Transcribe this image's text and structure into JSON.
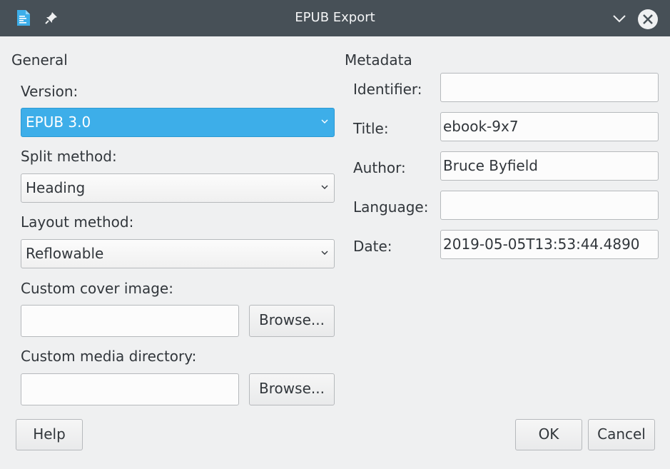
{
  "titlebar": {
    "title": "EPUB Export"
  },
  "general": {
    "heading": "General",
    "version_label": "Version:",
    "version_value": "EPUB 3.0",
    "split_label": "Split method:",
    "split_value": "Heading",
    "layout_label": "Layout method:",
    "layout_value": "Reflowable",
    "cover_label": "Custom cover image:",
    "cover_value": "",
    "cover_browse": "Browse...",
    "media_label": "Custom media directory:",
    "media_value": "",
    "media_browse": "Browse..."
  },
  "metadata": {
    "heading": "Metadata",
    "identifier_label": "Identifier:",
    "identifier_value": "",
    "title_label": "Title:",
    "title_value": "ebook-9x7",
    "author_label": "Author:",
    "author_value": "Bruce Byfield",
    "language_label": "Language:",
    "language_value": "",
    "date_label": "Date:",
    "date_value": "2019-05-05T13:53:44.4890"
  },
  "buttons": {
    "help": "Help",
    "ok": "OK",
    "cancel": "Cancel"
  },
  "colors": {
    "accent": "#3daee9",
    "titlebar": "#475057",
    "background": "#eff0f1"
  },
  "icons": {
    "app": "document-icon",
    "pin": "pin-icon",
    "minimize": "chevron-down-icon",
    "close": "close-icon"
  }
}
